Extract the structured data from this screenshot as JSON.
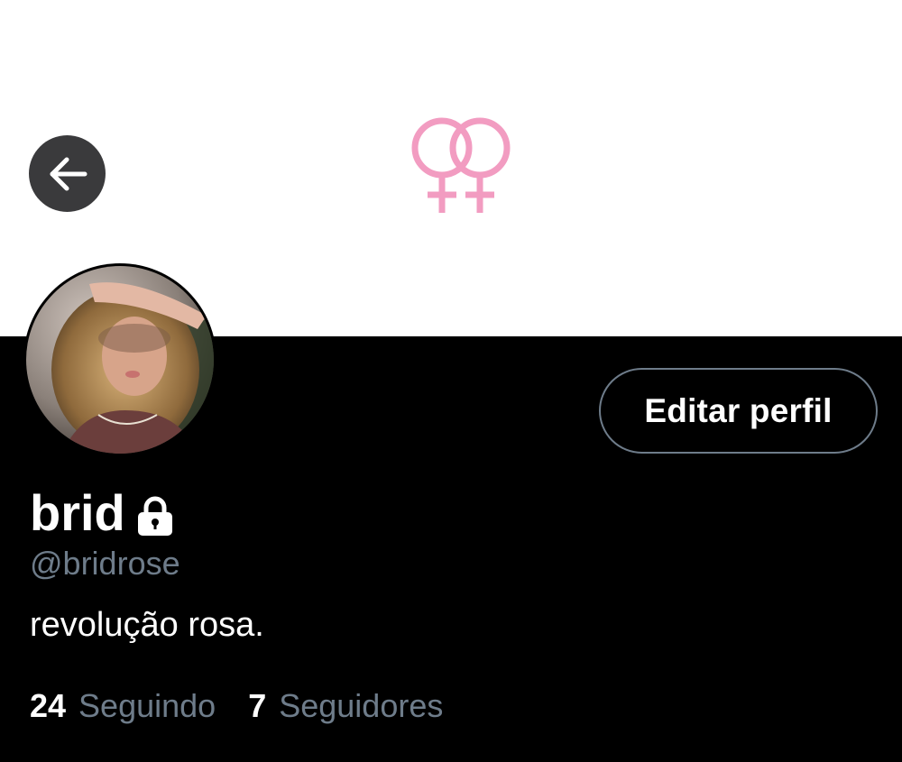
{
  "colors": {
    "banner_bg": "#ffffff",
    "emblem_pink": "#f29cc1",
    "page_bg": "#000000",
    "muted_text": "#6e7c8a",
    "back_button_bg": "#3a3a3c"
  },
  "banner": {
    "emblem_icon": "double-venus-symbol"
  },
  "header": {
    "back_icon": "arrow-left-icon"
  },
  "profile": {
    "display_name": "brid",
    "protected_icon": "lock-icon",
    "handle": "@bridrose",
    "bio": "revolução rosa.",
    "edit_label": "Editar perfil"
  },
  "stats": {
    "following_count": "24",
    "following_label": "Seguindo",
    "followers_count": "7",
    "followers_label": "Seguidores"
  }
}
